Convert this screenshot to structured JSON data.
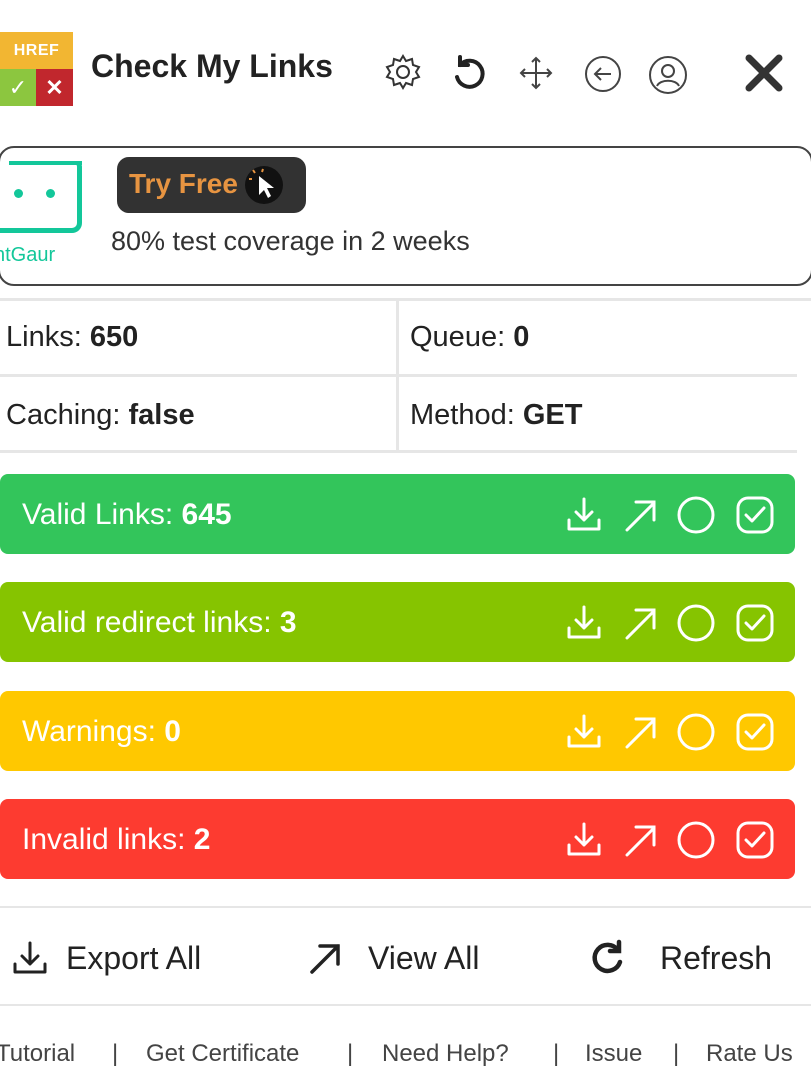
{
  "header": {
    "logo": {
      "top": "HREF",
      "left_mark": "✓",
      "right_mark": "✕"
    },
    "title": "Check My Links",
    "icons": [
      "gear-icon",
      "reload-icon",
      "move-icon",
      "back-arrow-icon",
      "user-icon",
      "close-icon"
    ]
  },
  "ad": {
    "logo_text": "ntGaur",
    "cta_label": "Try Free",
    "tagline": "80% test coverage in 2 weeks"
  },
  "stats": {
    "links_label": "Links: ",
    "links_value": "650",
    "queue_label": "Queue: ",
    "queue_value": "0",
    "caching_label": "Caching: ",
    "caching_value": "false",
    "method_label": "Method: ",
    "method_value": "GET"
  },
  "bars": [
    {
      "label": "Valid Links: ",
      "count": "645",
      "color": "#33c55b"
    },
    {
      "label": "Valid redirect links: ",
      "count": "3",
      "color": "#86c400"
    },
    {
      "label": "Warnings: ",
      "count": "0",
      "color": "#ffc800"
    },
    {
      "label": "Invalid links: ",
      "count": "2",
      "color": "#fd3b30"
    }
  ],
  "bar_icons": [
    "download-icon",
    "external-link-icon",
    "circle-icon",
    "checkbox-icon"
  ],
  "actions": {
    "export_all": "Export All",
    "view_all": "View All",
    "refresh": "Refresh"
  },
  "footer": {
    "links": [
      "Tutorial",
      "Get Certificate",
      "Need Help?",
      "Issue",
      "Rate Us"
    ],
    "separator": "|"
  }
}
